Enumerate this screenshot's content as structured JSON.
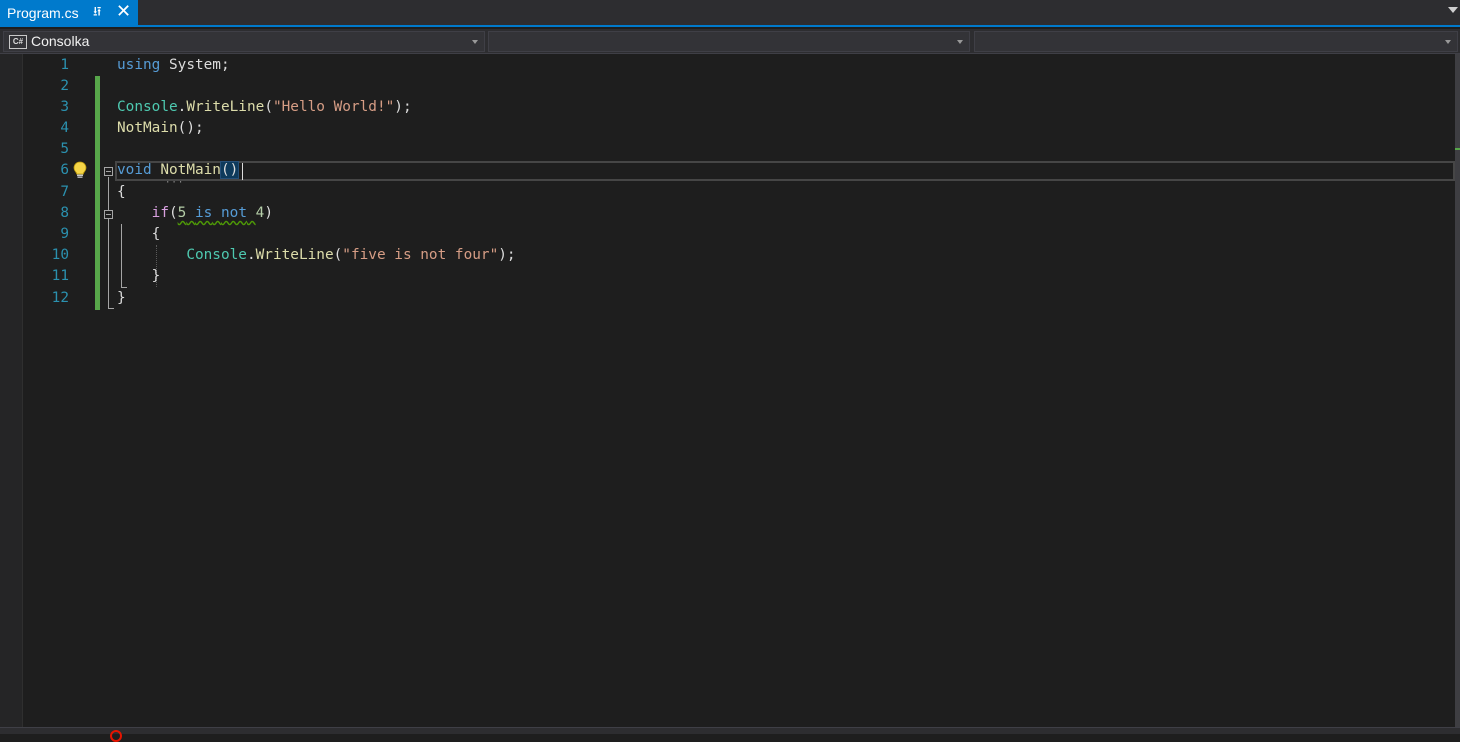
{
  "tabs": [
    {
      "title": "Program.cs",
      "pin_icon": "pin-icon",
      "close_icon": "close-icon",
      "active": true
    }
  ],
  "navigation": {
    "project": "Consolka",
    "project_icon": "csharp-project-icon",
    "project_icon_text": "C#",
    "type_member": "",
    "member": ""
  },
  "editor": {
    "line_numbers": [
      "1",
      "2",
      "3",
      "4",
      "5",
      "6",
      "7",
      "8",
      "9",
      "10",
      "11",
      "12"
    ],
    "code": {
      "l1_kw": "using",
      "l1_rest": " System;",
      "l3_type": "Console",
      "l3_dot": ".",
      "l3_method": "WriteLine",
      "l3_open": "(",
      "l3_str": "\"Hello World!\"",
      "l3_close": ");",
      "l4_method": "NotMain",
      "l4_rest": "();",
      "l6_kw": "void",
      "l6_sp": " ",
      "l6_method": "NotMain",
      "l6_parens": "()",
      "l7_brace": "{",
      "l8_indent": "    ",
      "l8_kw": "if",
      "l8_open": "(",
      "l8_num1": "5",
      "l8_sp1": " ",
      "l8_is": "is",
      "l8_sp2": " ",
      "l8_not": "not",
      "l8_sp3": " ",
      "l8_num2": "4",
      "l8_close": ")",
      "l9_brace": "    {",
      "l10_indent": "        ",
      "l10_type": "Console",
      "l10_dot": ".",
      "l10_method": "WriteLine",
      "l10_open": "(",
      "l10_str": "\"five is not four\"",
      "l10_close": ");",
      "l11_brace": "    }",
      "l12_brace": "}"
    },
    "lightbulb_icon": "lightbulb-icon",
    "current_line": 6
  },
  "colors": {
    "accent": "#007acc",
    "keyword": "#569cd6",
    "control_keyword": "#d8a0df",
    "type": "#4ec9b0",
    "method": "#dcdcaa",
    "string": "#d69d85",
    "number": "#b5cea8",
    "line_number": "#2b91af",
    "change_marker": "#57a64a"
  }
}
